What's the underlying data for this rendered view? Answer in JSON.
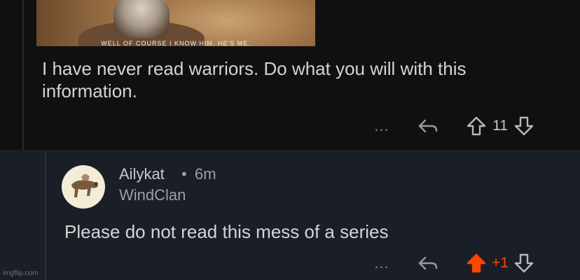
{
  "parent_comment": {
    "text": "I have never read warriors. Do what you will with this information.",
    "score": "11",
    "gif_caption": "WELL OF COURSE I KNOW HIM. HE'S ME."
  },
  "reply": {
    "username": "Ailykat",
    "separator": "•",
    "time": "6m",
    "flair": "WindClan",
    "text": "Please do not read this mess of a series",
    "score": "+1"
  },
  "actions": {
    "more": "..."
  },
  "icons": {
    "more": "more-dots-icon",
    "reply": "reply-arrow-icon",
    "upvote": "upvote-arrow-icon",
    "downvote": "downvote-arrow-icon"
  },
  "colors": {
    "upvoted": "#ff4500",
    "reply_bg": "#1a1f27",
    "parent_bg": "#101010"
  },
  "watermark": "imgflip.com"
}
